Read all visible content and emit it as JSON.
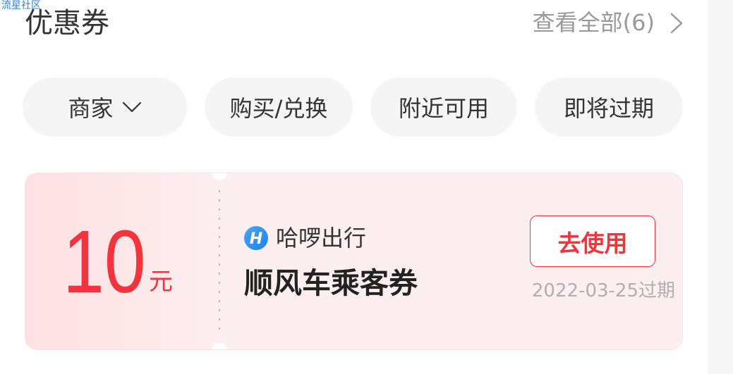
{
  "watermark": "流星社区",
  "header": {
    "title": "优惠券",
    "view_all_label": "查看全部(6)",
    "view_all_icon": "chevron-right-icon"
  },
  "filters": [
    {
      "label": "商家",
      "icon": "chevron-down-icon"
    },
    {
      "label": "购买/兑换"
    },
    {
      "label": "附近可用"
    },
    {
      "label": "即将过期"
    }
  ],
  "coupon": {
    "amount": "10",
    "unit": "元",
    "merchant_logo": "hellobike-logo-icon",
    "merchant_logo_text": "H",
    "merchant": "哈啰出行",
    "title": "顺风车乘客券",
    "action_label": "去使用",
    "expiry": "2022-03-25过期"
  },
  "colors": {
    "accent": "#f4333c",
    "text_primary": "#333333",
    "text_muted": "#999999",
    "chip_background": "#f5f5f5",
    "card_background": "#fdeef0",
    "logo_blue": "#2b8cf4",
    "watermark": "#2f7fe0"
  }
}
